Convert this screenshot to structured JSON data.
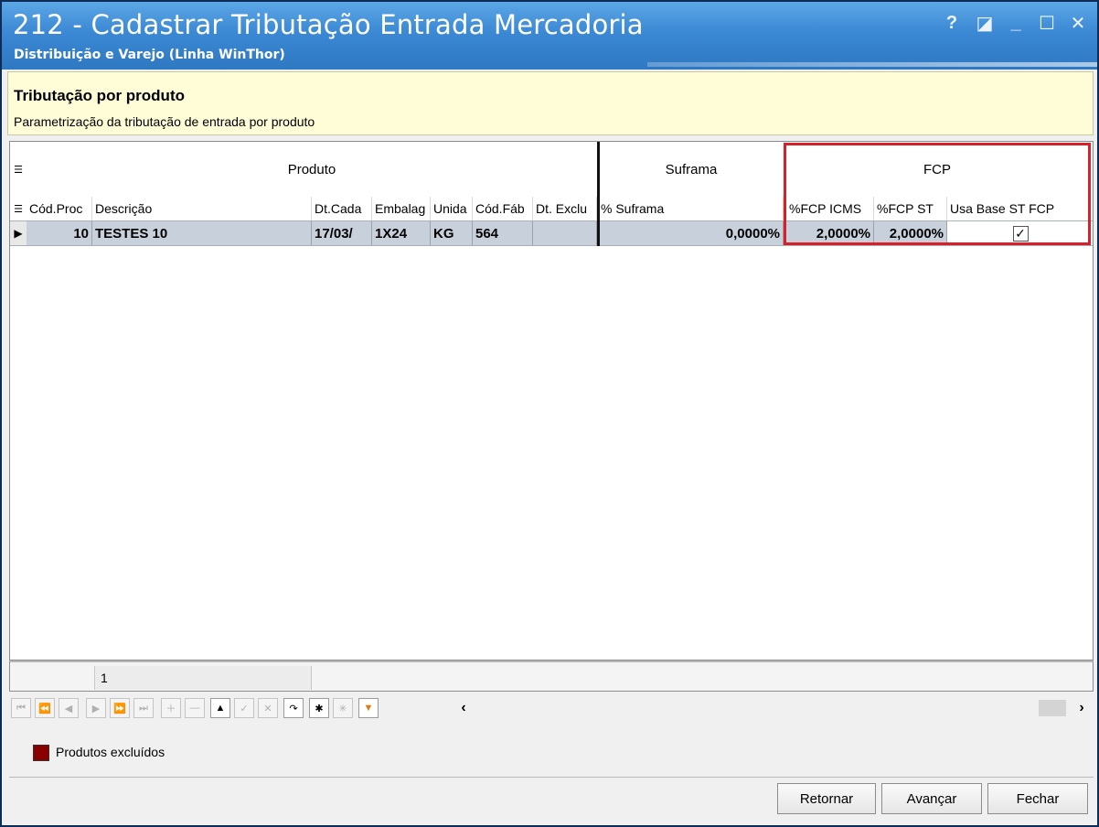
{
  "window": {
    "title": "212 - Cadastrar Tributação Entrada Mercadoria",
    "subtitle": "Distribuição e Varejo (Linha WinThor)",
    "controls": {
      "help": "?",
      "restore_alt": "◪",
      "minimize": "_",
      "maximize": "☐",
      "close": "✕"
    }
  },
  "header": {
    "title": "Tributação por produto",
    "subtitle": "Parametrização da tributação de entrada por produto"
  },
  "grid": {
    "bands": {
      "produto": "Produto",
      "suframa": "Suframa",
      "fcp": "FCP"
    },
    "columns": {
      "cod_prod": "Cód.Proc",
      "descricao": "Descrição",
      "dt_cad": "Dt.Cada",
      "embalagem": "Embalag",
      "unidade": "Unida",
      "cod_fab": "Cód.Fáb",
      "dt_excl": "Dt. Exclu",
      "suframa": "% Suframa",
      "fcp_icms": "%FCP ICMS",
      "fcp_st": "%FCP ST",
      "usa_base": "Usa Base ST FCP"
    },
    "rows": [
      {
        "cod_prod": "10",
        "descricao": "TESTES 10",
        "dt_cad": "17/03/",
        "embalagem": "1X24",
        "unidade": "KG",
        "cod_fab": "564",
        "dt_excl": "",
        "suframa": "0,0000%",
        "fcp_icms": "2,0000%",
        "fcp_st": "2,0000%",
        "usa_base_checked": true
      }
    ],
    "footer_count": "1",
    "accent_color": "#d7202a"
  },
  "legend": {
    "label": "Produtos excluídos",
    "color": "#8b0000"
  },
  "buttons": {
    "retornar": "Retornar",
    "avancar": "Avançar",
    "fechar": "Fechar"
  }
}
